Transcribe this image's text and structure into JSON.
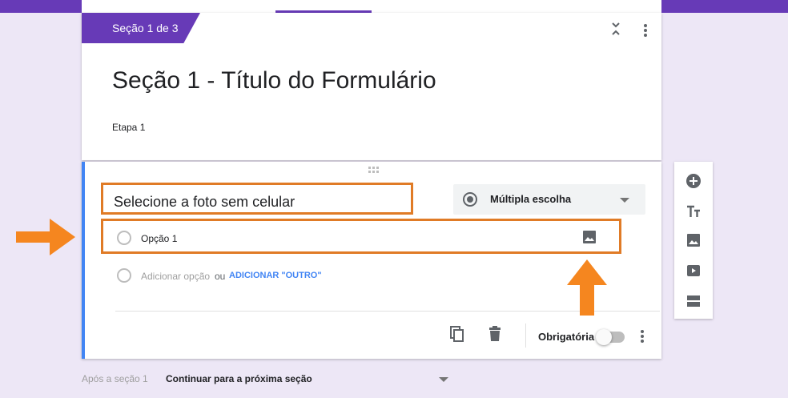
{
  "section": {
    "tag": "Seção 1 de 3",
    "title": "Seção 1 - Título do Formulário",
    "description": "Etapa 1"
  },
  "question": {
    "title": "Selecione a foto sem celular",
    "type": "Múltipla escolha",
    "options": [
      "Opção 1"
    ],
    "add_option": "Adicionar opção",
    "or": "ou",
    "add_other": "ADICIONAR \"OUTRO\"",
    "required_label": "Obrigatória",
    "required": false
  },
  "toolbar": {
    "items": [
      "add-question-icon",
      "add-title-icon",
      "add-image-icon",
      "add-video-icon",
      "add-section-icon"
    ]
  },
  "footer": {
    "after_section": "Após a seção 1",
    "next_action": "Continuar para a próxima seção"
  },
  "colors": {
    "accent": "#673ab7",
    "background": "#ede7f6",
    "highlight": "#e07b26",
    "active_border": "#4285f4"
  }
}
